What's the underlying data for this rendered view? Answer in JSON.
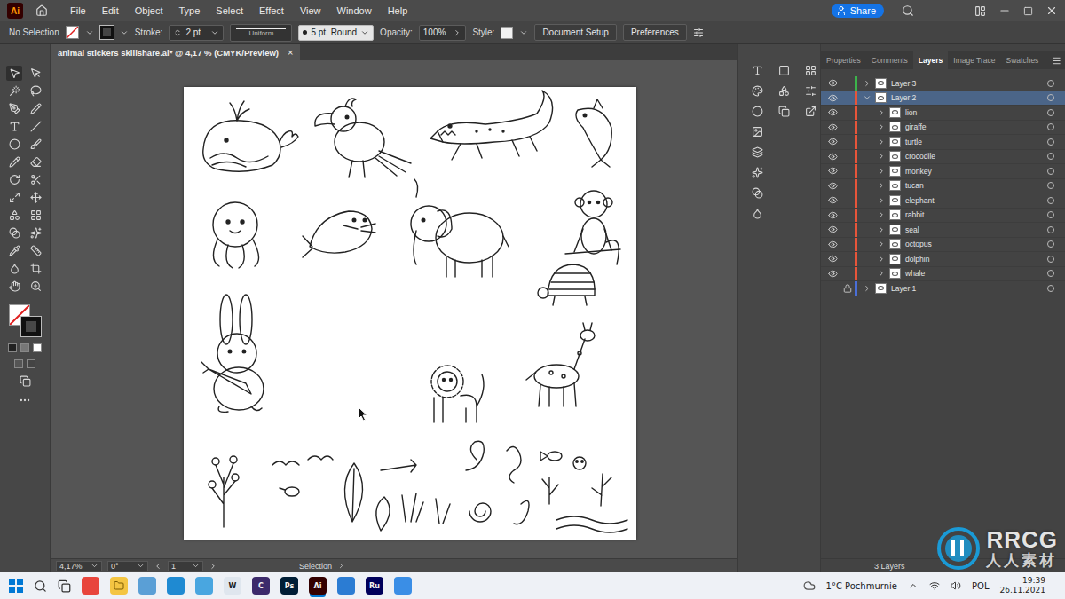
{
  "app": {
    "logo": "Ai",
    "menu": [
      "File",
      "Edit",
      "Object",
      "Type",
      "Select",
      "Effect",
      "View",
      "Window",
      "Help"
    ],
    "share": "Share"
  },
  "control_bar": {
    "selection": "No Selection",
    "stroke_label": "Stroke:",
    "stroke_weight": "2 pt",
    "profile": "Uniform",
    "brush": "5 pt. Round",
    "opacity_label": "Opacity:",
    "opacity": "100%",
    "style_label": "Style:",
    "buttons": [
      "Document Setup",
      "Preferences"
    ]
  },
  "document_tab": {
    "title": "animal stickers skillshare.ai* @ 4,17 % (CMYK/Preview)",
    "close": "×",
    "selected": true
  },
  "status_bar": {
    "zoom": "4,17%",
    "rotation": "0°",
    "artboard": "1",
    "tool": "Selection"
  },
  "panel": {
    "tabs": [
      {
        "label": "Properties",
        "selected": false
      },
      {
        "label": "Comments",
        "selected": false
      },
      {
        "label": "Layers",
        "selected": true
      },
      {
        "label": "Image Trace",
        "selected": false
      },
      {
        "label": "Swatches",
        "selected": false
      }
    ],
    "footer": "3 Layers"
  },
  "layers": [
    {
      "name": "Layer 3",
      "color": "#3cb44b",
      "visible": true,
      "locked": false,
      "expanded": false,
      "selected": false,
      "children": []
    },
    {
      "name": "Layer 2",
      "color": "#e8553a",
      "visible": true,
      "locked": false,
      "expanded": true,
      "selected": true,
      "children": [
        {
          "name": "lion",
          "visible": true,
          "locked": false,
          "expanded": false,
          "selected": false
        },
        {
          "name": "giraffe",
          "visible": true,
          "locked": false,
          "expanded": false,
          "selected": false
        },
        {
          "name": "turtle",
          "visible": true,
          "locked": false,
          "expanded": false,
          "selected": false
        },
        {
          "name": "crocodile",
          "visible": true,
          "locked": false,
          "expanded": false,
          "selected": false
        },
        {
          "name": "monkey",
          "visible": true,
          "locked": false,
          "expanded": false,
          "selected": false
        },
        {
          "name": "tucan",
          "visible": true,
          "locked": false,
          "expanded": false,
          "selected": false
        },
        {
          "name": "elephant",
          "visible": true,
          "locked": false,
          "expanded": false,
          "selected": false
        },
        {
          "name": "rabbit",
          "visible": true,
          "locked": false,
          "expanded": false,
          "selected": false
        },
        {
          "name": "seal",
          "visible": true,
          "locked": false,
          "expanded": false,
          "selected": false
        },
        {
          "name": "octopus",
          "visible": true,
          "locked": false,
          "expanded": false,
          "selected": false
        },
        {
          "name": "dolphin",
          "visible": true,
          "locked": false,
          "expanded": false,
          "selected": false
        },
        {
          "name": "whale",
          "visible": true,
          "locked": false,
          "expanded": false,
          "selected": false
        }
      ]
    },
    {
      "name": "Layer 1",
      "color": "#4a6fd8",
      "visible": false,
      "locked": true,
      "expanded": false,
      "selected": false,
      "children": []
    }
  ],
  "taskbar": {
    "apps": [
      {
        "color": "#e8453c",
        "active": false
      },
      {
        "color": "#f4c542",
        "active": false
      },
      {
        "color": "#5a9fd6",
        "active": false
      },
      {
        "color": "#1f8ad2",
        "active": false
      },
      {
        "color": "#49a6e0",
        "active": false
      },
      {
        "label": "W",
        "color": "#dfe6ee",
        "active": false
      },
      {
        "label": "C",
        "color": "#3c2a6b",
        "active": false
      },
      {
        "label": "Ps",
        "color": "#001e36",
        "active": false
      },
      {
        "label": "Ai",
        "color": "#330000",
        "active": true
      },
      {
        "color": "#2b7cd3",
        "active": false
      },
      {
        "label": "Ru",
        "color": "#00005b",
        "active": false
      },
      {
        "color": "#3a8ee6",
        "active": false
      }
    ],
    "weather": "1°C Pochmurnie",
    "language": "POL",
    "time": "19:39",
    "date": "26.11.2021"
  },
  "watermark": {
    "brand": "RRCG",
    "subtitle": "人人素材"
  }
}
